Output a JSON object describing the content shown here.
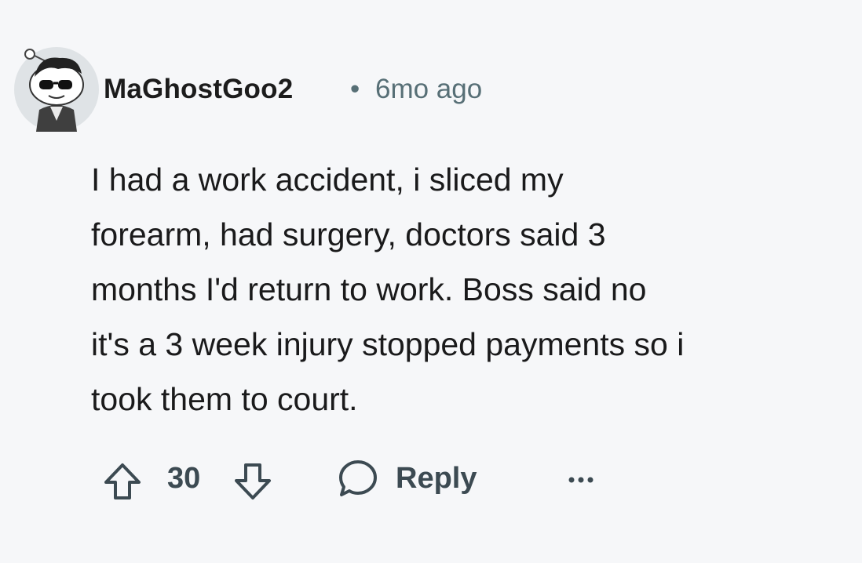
{
  "comment": {
    "author": "MaGhostGoo2",
    "separator": "•",
    "timestamp": "6mo ago",
    "body_lines": [
      "I had a work accident, i sliced my",
      "forearm, had surgery, doctors said 3",
      "months I'd return to work. Boss said no",
      "it's a 3 week injury stopped payments so i",
      "took them to court."
    ]
  },
  "actions": {
    "score": "30",
    "reply_label": "Reply"
  },
  "icons": {
    "upvote": "arrow-up-icon",
    "downvote": "arrow-down-icon",
    "reply": "speech-bubble-icon",
    "more": "ellipsis-icon"
  },
  "colors": {
    "background": "#f6f7f9",
    "text": "#1a1a1b",
    "muted": "#576f76",
    "action": "#3c4a52"
  }
}
